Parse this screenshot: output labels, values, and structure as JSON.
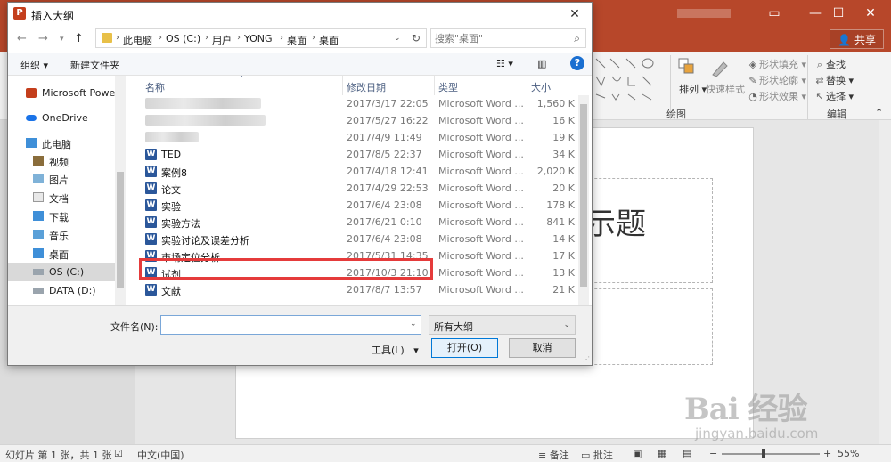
{
  "ppt": {
    "share_label": "共享",
    "ribbon": {
      "shape_fill": "形状填充",
      "shape_outline": "形状轮廓",
      "shape_effect": "形状效果",
      "arrange": "排列",
      "quick_styles": "快速样式",
      "find": "查找",
      "replace": "替换",
      "select": "选择",
      "group_drawing": "绘图",
      "group_editing": "编辑"
    },
    "slide_title_fragment": "示题"
  },
  "status": {
    "slide_info": "幻灯片 第 1 张，共 1 张",
    "language": "中文(中国)",
    "notes": "备注",
    "comments": "批注",
    "zoom": "55%"
  },
  "watermark": {
    "brand": "Bai 经验",
    "url": "jingyan.baidu.com"
  },
  "dialog": {
    "title": "插入大纲",
    "app_icon_letter": "P",
    "breadcrumbs": [
      "此电脑",
      "OS (C:)",
      "用户",
      "YONG",
      "桌面",
      "桌面"
    ],
    "search_placeholder": "搜索\"桌面\"",
    "toolbar": {
      "organize": "组织",
      "new_folder": "新建文件夹"
    },
    "nav": [
      {
        "label": "Microsoft Powe",
        "icon": "powerpoint-icon"
      },
      {
        "label": "OneDrive",
        "icon": "cloud-icon"
      },
      {
        "label": "此电脑",
        "icon": "computer-icon"
      },
      {
        "label": "视频",
        "icon": "video-folder-icon"
      },
      {
        "label": "图片",
        "icon": "pictures-folder-icon"
      },
      {
        "label": "文档",
        "icon": "documents-folder-icon"
      },
      {
        "label": "下载",
        "icon": "downloads-folder-icon"
      },
      {
        "label": "音乐",
        "icon": "music-folder-icon"
      },
      {
        "label": "桌面",
        "icon": "desktop-folder-icon"
      },
      {
        "label": "OS (C:)",
        "icon": "drive-icon"
      },
      {
        "label": "DATA (D:)",
        "icon": "drive-icon"
      }
    ],
    "columns": {
      "name": "名称",
      "date": "修改日期",
      "type": "类型",
      "size": "大小"
    },
    "files": [
      {
        "name": "",
        "date": "2017/3/17 22:05",
        "type": "Microsoft Word ...",
        "size": "1,560 K"
      },
      {
        "name": "",
        "date": "2017/5/27 16:22",
        "type": "Microsoft Word ...",
        "size": "16 K"
      },
      {
        "name": "",
        "date": "2017/4/9 11:49",
        "type": "Microsoft Word ...",
        "size": "19 K"
      },
      {
        "name": "TED",
        "date": "2017/8/5 22:37",
        "type": "Microsoft Word ...",
        "size": "34 K"
      },
      {
        "name": "案例8",
        "date": "2017/4/18 12:41",
        "type": "Microsoft Word ...",
        "size": "2,020 K"
      },
      {
        "name": "论文",
        "date": "2017/4/29 22:53",
        "type": "Microsoft Word ...",
        "size": "20 K"
      },
      {
        "name": "实验",
        "date": "2017/6/4 23:08",
        "type": "Microsoft Word ...",
        "size": "178 K"
      },
      {
        "name": "实验方法",
        "date": "2017/6/21 0:10",
        "type": "Microsoft Word ...",
        "size": "841 K"
      },
      {
        "name": "实验讨论及误差分析",
        "date": "2017/6/4 23:08",
        "type": "Microsoft Word ...",
        "size": "14 K"
      },
      {
        "name": "市场定位分析",
        "date": "2017/5/31 14:35",
        "type": "Microsoft Word ...",
        "size": "17 K"
      },
      {
        "name": "试剂",
        "date": "2017/10/3 21:10",
        "type": "Microsoft Word ...",
        "size": "13 K"
      },
      {
        "name": "文献",
        "date": "2017/8/7 13:57",
        "type": "Microsoft Word ...",
        "size": "21 K"
      }
    ],
    "filename_label": "文件名(N):",
    "filename_value": "",
    "filetype": "所有大纲",
    "tools": "工具(L)",
    "open": "打开(O)",
    "cancel": "取消"
  }
}
